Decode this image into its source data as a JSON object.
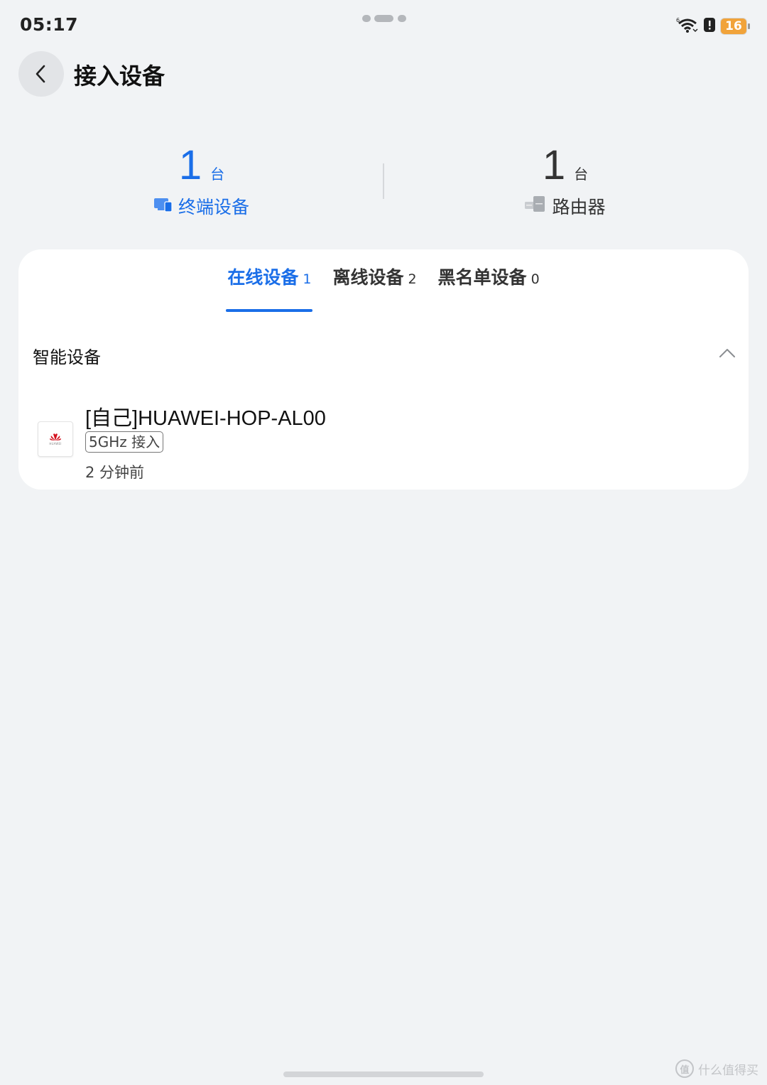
{
  "status_bar": {
    "time": "05:17",
    "battery_level": "16",
    "icons": [
      "wifi-icon",
      "alert-icon",
      "battery-icon"
    ]
  },
  "header": {
    "back_icon": "chevron-left-icon",
    "title": "接入设备"
  },
  "summary": {
    "terminals": {
      "count": "1",
      "unit": "台",
      "label": "终端设备",
      "icon": "terminal-device-icon",
      "color": "#1a6ee8"
    },
    "routers": {
      "count": "1",
      "unit": "台",
      "label": "路由器",
      "icon": "router-icon",
      "color": "#333333"
    }
  },
  "tabs": [
    {
      "label": "在线设备",
      "count": "1",
      "active": true
    },
    {
      "label": "离线设备",
      "count": "2",
      "active": false
    },
    {
      "label": "黑名单设备",
      "count": "0",
      "active": false
    }
  ],
  "section": {
    "title": "智能设备",
    "toggle_icon": "chevron-up-icon"
  },
  "devices": [
    {
      "name": "[自己]HUAWEI-HOP-AL00",
      "tag": "5GHz 接入",
      "last_seen": "2 分钟前",
      "logo_text": "HUAWEI",
      "icon": "huawei-logo-icon"
    }
  ],
  "watermark": {
    "text": "什么值得买",
    "mark": "值"
  },
  "colors": {
    "accent": "#1a6ee8",
    "background": "#f1f3f5",
    "card": "#ffffff",
    "battery": "#f1a33a"
  }
}
